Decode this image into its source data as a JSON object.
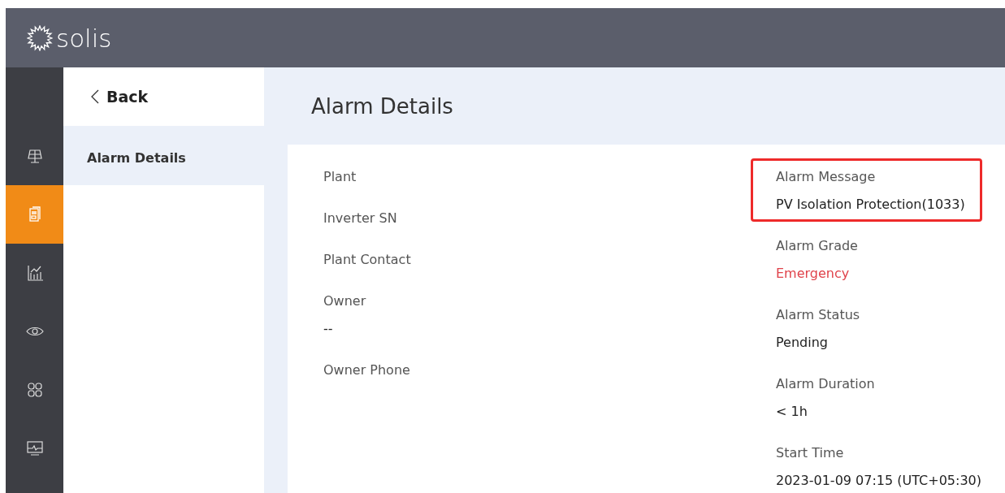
{
  "brand": {
    "name": "solis"
  },
  "rail": [
    {
      "selected": false
    },
    {
      "selected": true
    },
    {
      "selected": false
    },
    {
      "selected": false
    },
    {
      "selected": false
    },
    {
      "selected": false
    }
  ],
  "nav": {
    "back": "Back",
    "items": [
      {
        "label": "Alarm Details",
        "selected": true
      }
    ]
  },
  "page": {
    "title": "Alarm Details"
  },
  "details": {
    "left": [
      {
        "label": "Plant"
      },
      {
        "label": "Inverter SN"
      },
      {
        "label": "Plant Contact"
      },
      {
        "label": "Owner",
        "value": "--"
      },
      {
        "label": "Owner Phone"
      }
    ],
    "right": [
      {
        "label": "Alarm Message",
        "value": "PV Isolation Protection(1033)",
        "kind": "normal",
        "highlighted": true
      },
      {
        "label": "Alarm Grade",
        "value": "Emergency",
        "kind": "danger",
        "highlighted": false
      },
      {
        "label": "Alarm Status",
        "value": "Pending",
        "kind": "normal",
        "highlighted": false
      },
      {
        "label": "Alarm Duration",
        "value": "< 1h",
        "kind": "normal",
        "highlighted": false
      },
      {
        "label": "Start Time",
        "value": "2023-01-09 07:15 (UTC+05:30)",
        "kind": "normal",
        "highlighted": false
      }
    ]
  }
}
